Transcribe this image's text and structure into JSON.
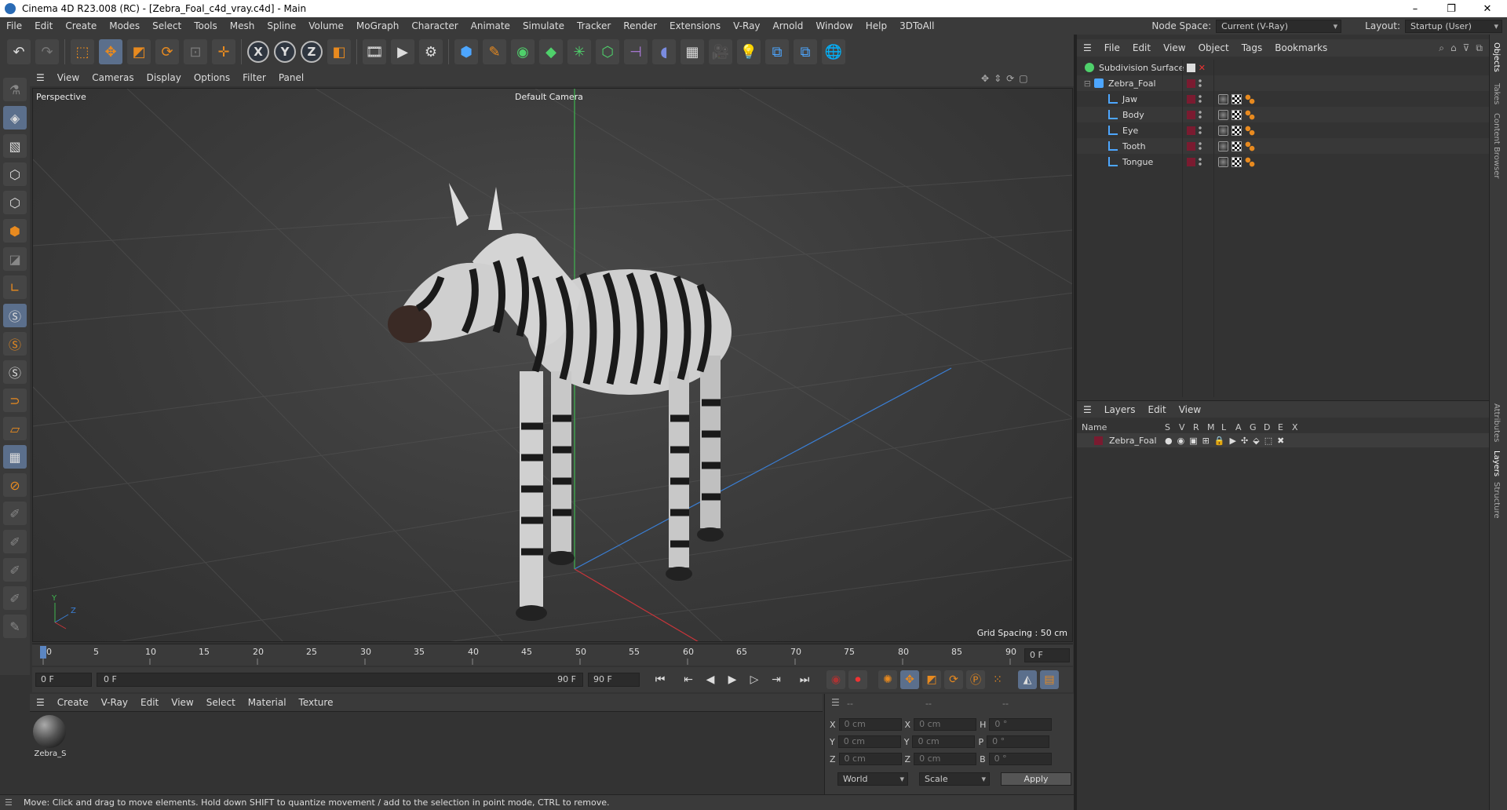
{
  "window": {
    "title": "Cinema 4D R23.008 (RC) - [Zebra_Foal_c4d_vray.c4d] - Main",
    "controls": [
      "–",
      "❐",
      "✕"
    ]
  },
  "menubar": {
    "items": [
      "File",
      "Edit",
      "Create",
      "Modes",
      "Select",
      "Tools",
      "Mesh",
      "Spline",
      "Volume",
      "MoGraph",
      "Character",
      "Animate",
      "Simulate",
      "Tracker",
      "Render",
      "Extensions",
      "V-Ray",
      "Arnold",
      "Window",
      "Help",
      "3DToAll"
    ],
    "node_space_label": "Node Space:",
    "node_space_value": "Current (V-Ray)",
    "layout_label": "Layout:",
    "layout_value": "Startup (User)"
  },
  "toolbar": {
    "axis_x": "X",
    "axis_y": "Y",
    "axis_z": "Z"
  },
  "viewport": {
    "menu": [
      "View",
      "Cameras",
      "Display",
      "Options",
      "Filter",
      "Panel"
    ],
    "label": "Perspective",
    "camera": "Default Camera",
    "grid_spacing": "Grid Spacing : 50 cm",
    "axis_y": "Y",
    "axis_z": "Z"
  },
  "timeline": {
    "ticks": [
      "0",
      "5",
      "10",
      "15",
      "20",
      "25",
      "30",
      "35",
      "40",
      "45",
      "50",
      "55",
      "60",
      "65",
      "70",
      "75",
      "80",
      "85",
      "90"
    ],
    "current_frame": "0 F",
    "start": "0 F",
    "range_start": "0 F",
    "range_end": "90 F",
    "end": "90 F"
  },
  "materials": {
    "menu": [
      "Create",
      "V-Ray",
      "Edit",
      "View",
      "Select",
      "Material",
      "Texture"
    ],
    "items": [
      {
        "name": "Zebra_S"
      }
    ]
  },
  "coords": {
    "headers": [
      "--",
      "--",
      "--"
    ],
    "rows": [
      {
        "a": "X",
        "av": "0 cm",
        "b": "X",
        "bv": "0 cm",
        "c": "H",
        "cv": "0 °"
      },
      {
        "a": "Y",
        "av": "0 cm",
        "b": "Y",
        "bv": "0 cm",
        "c": "P",
        "cv": "0 °"
      },
      {
        "a": "Z",
        "av": "0 cm",
        "b": "Z",
        "bv": "0 cm",
        "c": "B",
        "cv": "0 °"
      }
    ],
    "mode": "World",
    "scale": "Scale",
    "apply": "Apply"
  },
  "status": "Move: Click and drag to move elements. Hold down SHIFT to quantize movement / add to the selection in point mode, CTRL to remove.",
  "objects": {
    "menu": [
      "File",
      "Edit",
      "View",
      "Object",
      "Tags",
      "Bookmarks"
    ],
    "tree": [
      {
        "name": "Subdivision Surface",
        "level": 0
      },
      {
        "name": "Zebra_Foal",
        "level": 1
      },
      {
        "name": "Jaw",
        "level": 2
      },
      {
        "name": "Body",
        "level": 2
      },
      {
        "name": "Eye",
        "level": 2
      },
      {
        "name": "Tooth",
        "level": 2
      },
      {
        "name": "Tongue",
        "level": 2
      }
    ]
  },
  "layers": {
    "menu": [
      "Layers",
      "Edit",
      "View"
    ],
    "headers": [
      "Name",
      "S",
      "V",
      "R",
      "M",
      "L",
      "A",
      "G",
      "D",
      "E",
      "X"
    ],
    "rows": [
      {
        "name": "Zebra_Foal",
        "color": "#7a1b30"
      }
    ]
  },
  "sidetabs": [
    "Objects",
    "Takes",
    "Content Browser",
    "Attributes",
    "Layers",
    "Structure"
  ],
  "colors": {
    "accent": "#e88a1f",
    "active": "#5b6f8c",
    "layer": "#7a1b30"
  }
}
